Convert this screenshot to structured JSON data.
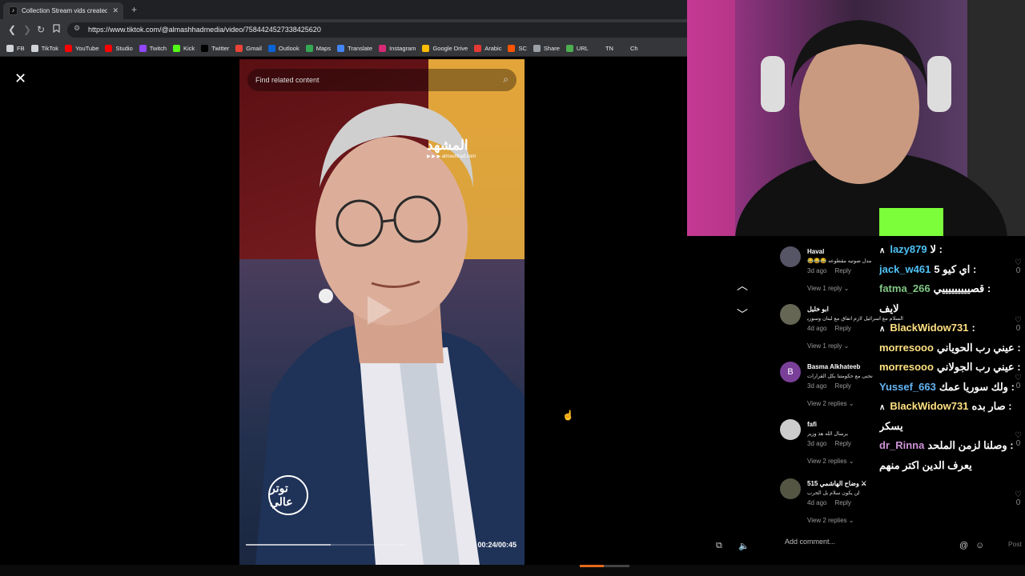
{
  "browser": {
    "tab_title": "Collection Stream vids created b",
    "tab_favicon": "tiktok-icon",
    "url": "https://www.tiktok.com/@almashhadmedia/video/7584424527338425620",
    "bookmarks": [
      {
        "label": "FB",
        "icon": "folder-icon",
        "color": "#cfd2d6"
      },
      {
        "label": "TikTok",
        "icon": "folder-icon",
        "color": "#cfd2d6"
      },
      {
        "label": "YouTube",
        "icon": "youtube-icon",
        "color": "#ff0000"
      },
      {
        "label": "Studio",
        "icon": "studio-icon",
        "color": "#ff0000"
      },
      {
        "label": "Twitch",
        "icon": "twitch-icon",
        "color": "#9146ff"
      },
      {
        "label": "Kick",
        "icon": "kick-icon",
        "color": "#53fc18"
      },
      {
        "label": "Twitter",
        "icon": "x-icon",
        "color": "#000000"
      },
      {
        "label": "Gmail",
        "icon": "gmail-icon",
        "color": "#ea4335"
      },
      {
        "label": "Outlook",
        "icon": "outlook-icon",
        "color": "#0a64d6"
      },
      {
        "label": "Maps",
        "icon": "maps-icon",
        "color": "#34a853"
      },
      {
        "label": "Translate",
        "icon": "translate-icon",
        "color": "#4285f4"
      },
      {
        "label": "Instagram",
        "icon": "instagram-icon",
        "color": "#d62976"
      },
      {
        "label": "Google Drive",
        "icon": "drive-icon",
        "color": "#fbbc04"
      },
      {
        "label": "Arabic",
        "icon": "arabic-icon",
        "color": "#e53935"
      },
      {
        "label": "SC",
        "icon": "sc-icon",
        "color": "#ff5500"
      },
      {
        "label": "Share",
        "icon": "cloud-icon",
        "color": "#9aa0a6"
      },
      {
        "label": "URL",
        "icon": "url-icon",
        "color": "#4caf50"
      },
      {
        "label": "TN",
        "icon": "tn-icon",
        "color": "#35363a"
      },
      {
        "label": "Ch",
        "icon": "globe-icon",
        "color": "#35363a"
      }
    ]
  },
  "video": {
    "search_placeholder": "Find related content",
    "logo_text": "المشهد",
    "logo_sub": "▶ ▶ ▶ almashhad.com",
    "watermark": "توتر عالي",
    "timecode": "00:24/00:45",
    "progress": 0.53
  },
  "comments": [
    {
      "name": "Haval",
      "avatar": "",
      "text": "مدل صوتيه مقطوعه 😂😂😂",
      "age": "3d ago",
      "reply": "Reply",
      "likes": "0",
      "view_replies": "View 1 reply",
      "avatar_color": "#556"
    },
    {
      "name": "ابو خليل",
      "avatar": "",
      "text": "السلام مع اسرائيل لازم اتفاق مع لبنان وسوريا",
      "age": "4d ago",
      "reply": "Reply",
      "likes": "0",
      "view_replies": "View 1 reply",
      "avatar_color": "#665"
    },
    {
      "name": "Basma Alkhateeb",
      "avatar": "B",
      "text": "نحنى مع حكومتنا بكل القرارات",
      "age": "3d ago",
      "reply": "Reply",
      "likes": "0",
      "view_replies": "View 2 replies",
      "avatar_color": "#7a3f99"
    },
    {
      "name": "fafi",
      "avatar": "",
      "text": "يرسال الله هذ وزير",
      "age": "3d ago",
      "reply": "Reply",
      "likes": "0",
      "view_replies": "View 2 replies",
      "avatar_color": "#ccc"
    },
    {
      "name": "وضاح الهاشمي 515 ⚔",
      "avatar": "",
      "text": "لن يكون سلام بل الحرب",
      "age": "4d ago",
      "reply": "Reply",
      "likes": "0",
      "view_replies": "View 2 replies",
      "avatar_color": "#554"
    }
  ],
  "chat": [
    {
      "user": "lazy879",
      "msg": ": لا",
      "color": "#4fc3f7",
      "caret": true
    },
    {
      "user": "jack_w461",
      "msg": ": اي كيو 5",
      "color": "#4fc3f7",
      "caret": false
    },
    {
      "user": "fatma_266",
      "msg": ": قصيييييييييي",
      "color": "#81c784",
      "caret": false
    },
    {
      "user": "",
      "msg": "لايف",
      "color": "#fff",
      "caret": false
    },
    {
      "user": "BlackWidow731",
      "msg": ":",
      "color": "#ffe082",
      "caret": true
    },
    {
      "user": "morresooo",
      "msg": ": عيني رب الحوياني",
      "color": "#ffe082",
      "caret": false
    },
    {
      "user": "morresooo",
      "msg": ": عيني رب الجولاني",
      "color": "#ffe082",
      "caret": false
    },
    {
      "user": "Yussef_663",
      "msg": ": ولك سوريا عمك",
      "color": "#64b5f6",
      "caret": false
    },
    {
      "user": "BlackWidow731",
      "msg": ": صار بده",
      "color": "#ffe082",
      "caret": true
    },
    {
      "user": "",
      "msg": "يسكر",
      "color": "#fff",
      "caret": false
    },
    {
      "user": "dr_Rinna",
      "msg": ": وصلنا لزمن الملحد",
      "color": "#ce93d8",
      "caret": false
    },
    {
      "user": "",
      "msg": "يعرف الدين اكتر منهم",
      "color": "#fff",
      "caret": false
    }
  ],
  "footer": {
    "add_comment_placeholder": "Add comment...",
    "post_label": "Post"
  }
}
